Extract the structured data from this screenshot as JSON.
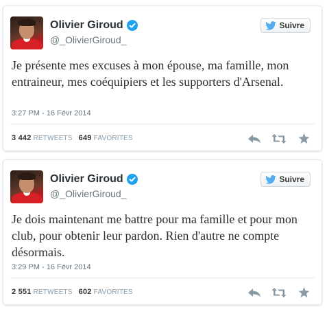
{
  "colors": {
    "verified": "#1da1f2",
    "bird": "#55acee",
    "action_icon": "#8899a6",
    "jersey": "#d71f26"
  },
  "tweets": [
    {
      "author_name": "Olivier Giroud",
      "handle": "@_OlivierGiroud_",
      "follow_label": "Suivre",
      "text": "Je présente mes excuses à mon épouse, ma famille, mon entraineur, mes coéquipiers et les supporters d'Arsenal.",
      "timestamp": "3:27 PM - 16 Févr 2014",
      "retweets": "3 442",
      "retweets_label": "RETWEETS",
      "favorites": "649",
      "favorites_label": "FAVORITES",
      "icons": [
        "verified-icon",
        "bird-icon",
        "reply-icon",
        "retweet-icon",
        "favorite-icon"
      ]
    },
    {
      "author_name": "Olivier Giroud",
      "handle": "@_OlivierGiroud_",
      "follow_label": "Suivre",
      "text": "Je dois maintenant me battre pour ma famille et pour mon club, pour obtenir leur pardon. Rien d'autre ne compte désormais.",
      "timestamp": "3:29 PM - 16 Févr 2014",
      "retweets": "2 551",
      "retweets_label": "RETWEETS",
      "favorites": "602",
      "favorites_label": "FAVORITES",
      "icons": [
        "verified-icon",
        "bird-icon",
        "reply-icon",
        "retweet-icon",
        "favorite-icon"
      ]
    }
  ]
}
